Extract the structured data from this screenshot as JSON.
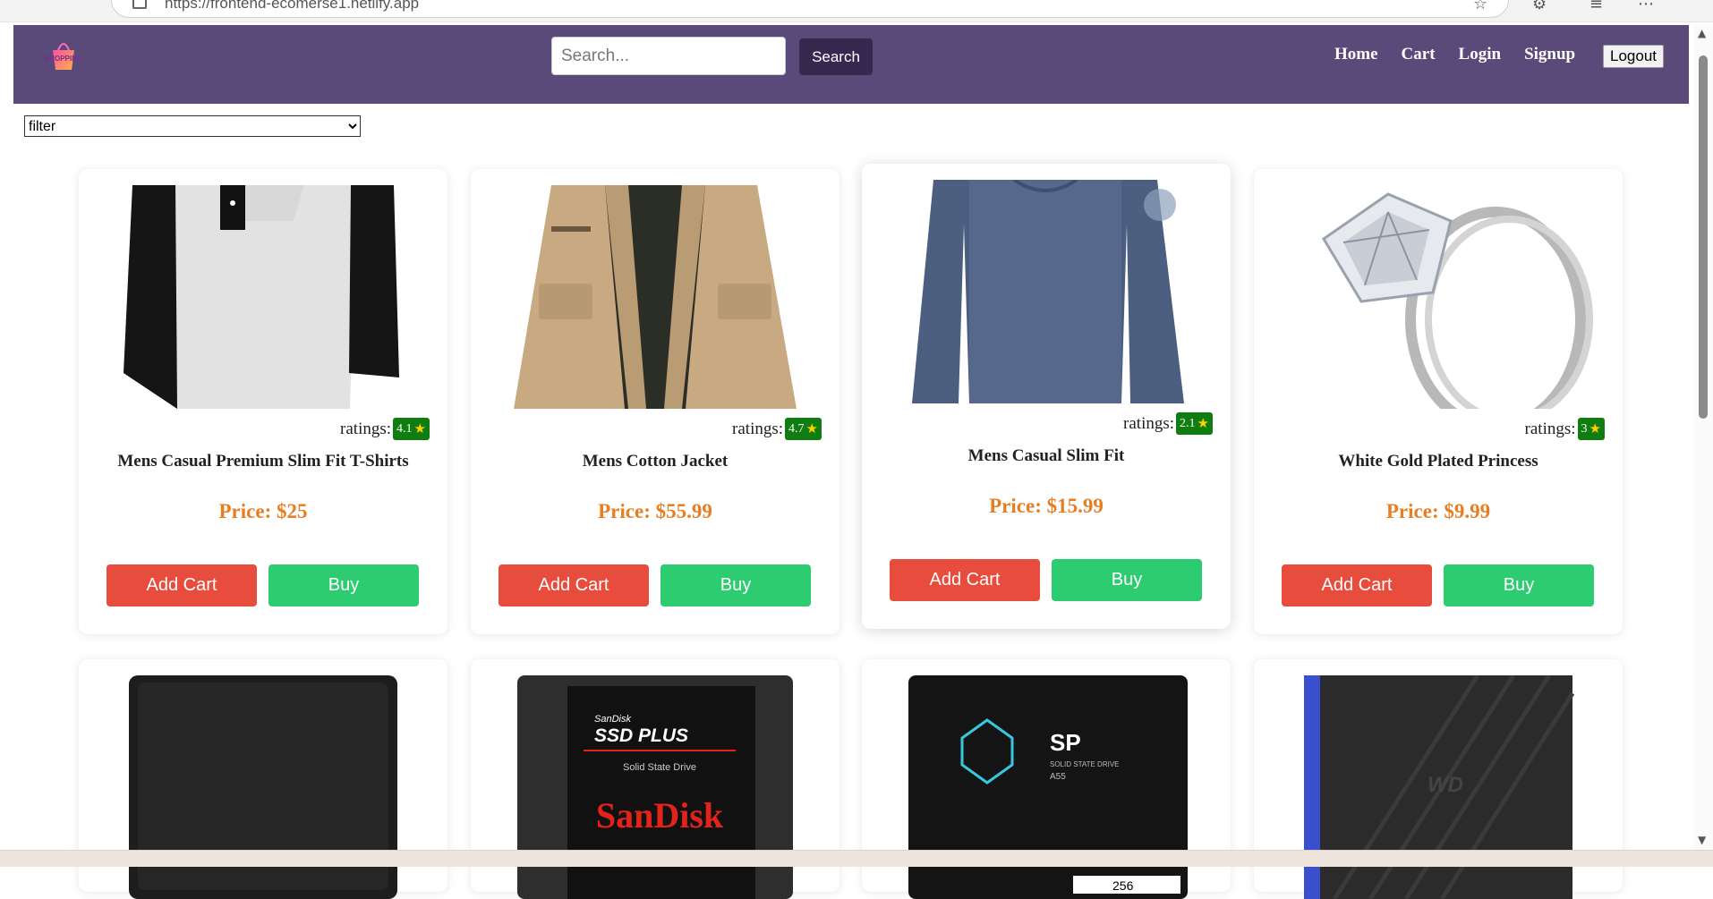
{
  "browser": {
    "url": "https://frontend-ecomerse1.netlify.app"
  },
  "navbar": {
    "logo_text": "SHOPPING",
    "search_placeholder": "Search...",
    "search_button": "Search",
    "links": [
      "Home",
      "Cart",
      "Login",
      "Signup"
    ],
    "logout": "Logout"
  },
  "filter": {
    "selected": "filter"
  },
  "products": [
    {
      "ratings_label": "ratings:",
      "rating": "4.1",
      "title": "Mens Casual Premium Slim Fit T-Shirts",
      "price": "Price: $25",
      "add_label": "Add Cart",
      "buy_label": "Buy",
      "image": "tshirt-image"
    },
    {
      "ratings_label": "ratings:",
      "rating": "4.7",
      "title": "Mens Cotton Jacket",
      "price": "Price: $55.99",
      "add_label": "Add Cart",
      "buy_label": "Buy",
      "image": "jacket-image"
    },
    {
      "ratings_label": "ratings:",
      "rating": "2.1",
      "title": "Mens Casual Slim Fit",
      "price": "Price: $15.99",
      "add_label": "Add Cart",
      "buy_label": "Buy",
      "image": "longsleeve-image"
    },
    {
      "ratings_label": "ratings:",
      "rating": "3",
      "title": "White Gold Plated Princess",
      "price": "Price: $9.99",
      "add_label": "Add Cart",
      "buy_label": "Buy",
      "image": "ring-image"
    }
  ],
  "row2": [
    {
      "image": "hard-drive-image"
    },
    {
      "image": "ssd-image",
      "brand_small": "SanDisk",
      "product_line": "SSD PLUS",
      "subtitle": "Solid State Drive",
      "brand_large": "SanDisk"
    },
    {
      "image": "sp-ssd-image",
      "brand": "SP",
      "subtitle": "SOLID STATE DRIVE",
      "model": "A55",
      "capacity": "256"
    },
    {
      "image": "wd-drive-image",
      "brand": "WD"
    }
  ],
  "colors": {
    "navbar": "#5a4a7a",
    "price": "#e67e22",
    "add_cart": "#e74c3c",
    "buy": "#2ecc71",
    "rating_badge": "#0f7d0f"
  }
}
